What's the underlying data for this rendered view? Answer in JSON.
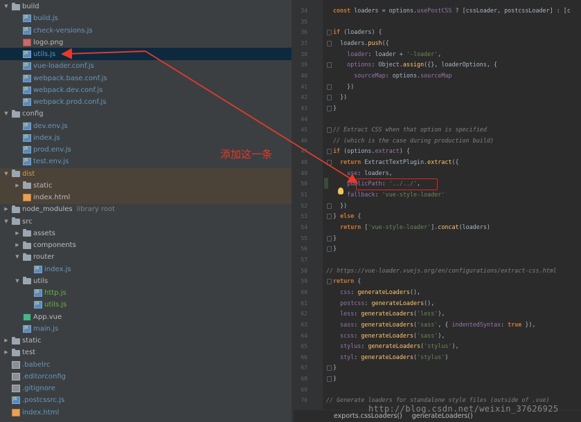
{
  "tree": {
    "rows": [
      {
        "label": "build",
        "kind": "folder",
        "depth": 0,
        "open": true
      },
      {
        "label": "build.js",
        "kind": "js",
        "depth": 1,
        "color": "mod"
      },
      {
        "label": "check-versions.js",
        "kind": "js",
        "depth": 1,
        "color": "mod"
      },
      {
        "label": "logo.png",
        "kind": "png",
        "depth": 1,
        "color": "plain"
      },
      {
        "label": "utils.js",
        "kind": "js",
        "depth": 1,
        "color": "mod",
        "selected": true
      },
      {
        "label": "vue-loader.conf.js",
        "kind": "js",
        "depth": 1,
        "color": "mod"
      },
      {
        "label": "webpack.base.conf.js",
        "kind": "js",
        "depth": 1,
        "color": "mod"
      },
      {
        "label": "webpack.dev.conf.js",
        "kind": "js",
        "depth": 1,
        "color": "mod"
      },
      {
        "label": "webpack.prod.conf.js",
        "kind": "js",
        "depth": 1,
        "color": "mod"
      },
      {
        "label": "config",
        "kind": "folder",
        "depth": 0,
        "open": true
      },
      {
        "label": "dev.env.js",
        "kind": "js",
        "depth": 1,
        "color": "mod"
      },
      {
        "label": "index.js",
        "kind": "js",
        "depth": 1,
        "color": "mod"
      },
      {
        "label": "prod.env.js",
        "kind": "js",
        "depth": 1,
        "color": "mod"
      },
      {
        "label": "test.env.js",
        "kind": "js",
        "depth": 1,
        "color": "mod"
      },
      {
        "label": "dist",
        "kind": "folder",
        "depth": 0,
        "open": true,
        "color": "unt"
      },
      {
        "label": "static",
        "kind": "folder",
        "depth": 1,
        "open": false
      },
      {
        "label": "index.html",
        "kind": "html",
        "depth": 1,
        "color": "plain"
      },
      {
        "label": "node_modules",
        "kind": "folder",
        "depth": 0,
        "open": false,
        "extra": "library root"
      },
      {
        "label": "src",
        "kind": "folder",
        "depth": 0,
        "open": true
      },
      {
        "label": "assets",
        "kind": "folder",
        "depth": 1,
        "open": false
      },
      {
        "label": "components",
        "kind": "folder",
        "depth": 1,
        "open": false
      },
      {
        "label": "router",
        "kind": "folder",
        "depth": 1,
        "open": true
      },
      {
        "label": "index.js",
        "kind": "js",
        "depth": 2,
        "color": "mod"
      },
      {
        "label": "utils",
        "kind": "folder",
        "depth": 1,
        "open": true
      },
      {
        "label": "http.js",
        "kind": "js",
        "depth": 2,
        "color": "add"
      },
      {
        "label": "utils.js",
        "kind": "js",
        "depth": 2,
        "color": "add"
      },
      {
        "label": "App.vue",
        "kind": "vue",
        "depth": 1,
        "color": "plain"
      },
      {
        "label": "main.js",
        "kind": "js",
        "depth": 1,
        "color": "mod"
      },
      {
        "label": "static",
        "kind": "folder",
        "depth": 0,
        "open": false
      },
      {
        "label": "test",
        "kind": "folder",
        "depth": 0,
        "open": false
      },
      {
        "label": ".babelrc",
        "kind": "cfg",
        "depth": 0,
        "color": "mod"
      },
      {
        "label": ".editorconfig",
        "kind": "cfg",
        "depth": 0,
        "color": "mod"
      },
      {
        "label": ".gitignore",
        "kind": "cfg",
        "depth": 0,
        "color": "mod"
      },
      {
        "label": ".postcssrc.js",
        "kind": "js",
        "depth": 0,
        "color": "mod"
      },
      {
        "label": "index.html",
        "kind": "html",
        "depth": 0,
        "color": "mod"
      }
    ]
  },
  "annotation": {
    "note": "添加这一条"
  },
  "editor": {
    "lines": [
      {
        "n": "34",
        "fold": false,
        "tokens": [
          [
            "kw",
            "const "
          ],
          [
            "",
            "loaders = options."
          ],
          [
            "pr",
            "usePostCSS"
          ],
          [
            "",
            " ? [cssLoader, postcssLoader] : [c"
          ]
        ]
      },
      {
        "n": "35",
        "fold": false,
        "tokens": []
      },
      {
        "n": "36",
        "fold": true,
        "tokens": [
          [
            "kw",
            "if "
          ],
          [
            "",
            "(loaders) {"
          ]
        ]
      },
      {
        "n": "37",
        "fold": true,
        "tokens": [
          [
            "",
            "  loaders."
          ],
          [
            "fn",
            "push"
          ],
          [
            "",
            "({"
          ]
        ]
      },
      {
        "n": "38",
        "fold": false,
        "tokens": [
          [
            "pr",
            "    loader"
          ],
          [
            "",
            ": loader + "
          ],
          [
            "st",
            "'-loader'"
          ],
          [
            "",
            ","
          ]
        ]
      },
      {
        "n": "39",
        "fold": true,
        "tokens": [
          [
            "pr",
            "    options"
          ],
          [
            "",
            ": Object."
          ],
          [
            "fn",
            "assign"
          ],
          [
            "",
            "({}, loaderOptions, {"
          ]
        ]
      },
      {
        "n": "40",
        "fold": false,
        "tokens": [
          [
            "pr",
            "      sourceMap"
          ],
          [
            "",
            ": options."
          ],
          [
            "pr",
            "sourceMap"
          ]
        ]
      },
      {
        "n": "41",
        "fold": true,
        "tokens": [
          [
            "",
            "    })"
          ]
        ]
      },
      {
        "n": "42",
        "fold": true,
        "tokens": [
          [
            "",
            "  })"
          ]
        ]
      },
      {
        "n": "43",
        "fold": true,
        "tokens": [
          [
            "",
            "}"
          ]
        ]
      },
      {
        "n": "44",
        "fold": false,
        "tokens": []
      },
      {
        "n": "45",
        "fold": true,
        "tokens": [
          [
            "cm",
            "// Extract CSS when that option is specified"
          ]
        ]
      },
      {
        "n": "46",
        "fold": false,
        "tokens": [
          [
            "cm",
            "// (which is the case during production build)"
          ]
        ]
      },
      {
        "n": "47",
        "fold": true,
        "tokens": [
          [
            "kw",
            "if "
          ],
          [
            "",
            "(options."
          ],
          [
            "pr",
            "extract"
          ],
          [
            "",
            ") {"
          ]
        ]
      },
      {
        "n": "48",
        "fold": true,
        "tokens": [
          [
            "kw",
            "  return "
          ],
          [
            "",
            "ExtractTextPlugin."
          ],
          [
            "fn",
            "extract"
          ],
          [
            "",
            "({"
          ]
        ]
      },
      {
        "n": "49",
        "fold": false,
        "tokens": [
          [
            "pr",
            "    use"
          ],
          [
            "",
            ": loaders,"
          ]
        ]
      },
      {
        "n": "50",
        "fold": false,
        "tokens": [
          [
            "pr",
            "    publicPath"
          ],
          [
            "",
            ": "
          ],
          [
            "st",
            "'../../'"
          ],
          [
            "",
            ","
          ]
        ]
      },
      {
        "n": "51",
        "fold": false,
        "tokens": [
          [
            "pr",
            "    fallback"
          ],
          [
            "",
            ": "
          ],
          [
            "st",
            "'vue-style-loader'"
          ]
        ]
      },
      {
        "n": "52",
        "fold": true,
        "tokens": [
          [
            "",
            "  })"
          ]
        ]
      },
      {
        "n": "53",
        "fold": true,
        "tokens": [
          [
            "",
            "} "
          ],
          [
            "kw",
            "else "
          ],
          [
            "",
            "{"
          ]
        ]
      },
      {
        "n": "54",
        "fold": false,
        "tokens": [
          [
            "kw",
            "  return "
          ],
          [
            "",
            "["
          ],
          [
            "st",
            "'vue-style-loader'"
          ],
          [
            "",
            "]."
          ],
          [
            "fn",
            "concat"
          ],
          [
            "",
            "(loaders)"
          ]
        ]
      },
      {
        "n": "55",
        "fold": true,
        "tokens": [
          [
            "",
            "}"
          ]
        ]
      },
      {
        "n": "56",
        "fold": true,
        "tokens": [
          [
            "",
            "}"
          ]
        ]
      },
      {
        "n": "57",
        "fold": false,
        "tokens": []
      },
      {
        "n": "58",
        "fold": false,
        "tokens": [
          [
            "cm",
            "// https://vue-loader.vuejs.org/en/configurations/extract-css.html"
          ]
        ]
      },
      {
        "n": "59",
        "fold": true,
        "tokens": [
          [
            "kw",
            "return "
          ],
          [
            "",
            "{"
          ]
        ]
      },
      {
        "n": "60",
        "fold": false,
        "tokens": [
          [
            "pr",
            "  css"
          ],
          [
            "",
            ": "
          ],
          [
            "fn",
            "generateLoaders"
          ],
          [
            "",
            "(),"
          ]
        ]
      },
      {
        "n": "61",
        "fold": false,
        "tokens": [
          [
            "pr",
            "  postcss"
          ],
          [
            "",
            ": "
          ],
          [
            "fn",
            "generateLoaders"
          ],
          [
            "",
            "(),"
          ]
        ]
      },
      {
        "n": "62",
        "fold": false,
        "tokens": [
          [
            "pr",
            "  less"
          ],
          [
            "",
            ": "
          ],
          [
            "fn",
            "generateLoaders"
          ],
          [
            "",
            "("
          ],
          [
            "st",
            "'less'"
          ],
          [
            "",
            "),"
          ]
        ]
      },
      {
        "n": "63",
        "fold": false,
        "tokens": [
          [
            "pr",
            "  sass"
          ],
          [
            "",
            ": "
          ],
          [
            "fn",
            "generateLoaders"
          ],
          [
            "",
            "("
          ],
          [
            "st",
            "'sass'"
          ],
          [
            "",
            ", { "
          ],
          [
            "pr",
            "indentedSyntax"
          ],
          [
            "",
            ": "
          ],
          [
            "kw",
            "true "
          ],
          [
            "",
            "}),"
          ]
        ]
      },
      {
        "n": "64",
        "fold": false,
        "tokens": [
          [
            "pr",
            "  scss"
          ],
          [
            "",
            ": "
          ],
          [
            "fn",
            "generateLoaders"
          ],
          [
            "",
            "("
          ],
          [
            "st",
            "'sass'"
          ],
          [
            "",
            "),"
          ]
        ]
      },
      {
        "n": "65",
        "fold": false,
        "tokens": [
          [
            "pr",
            "  stylus"
          ],
          [
            "",
            ": "
          ],
          [
            "fn",
            "generateLoaders"
          ],
          [
            "",
            "("
          ],
          [
            "st",
            "'stylus'"
          ],
          [
            "",
            "),"
          ]
        ]
      },
      {
        "n": "66",
        "fold": false,
        "tokens": [
          [
            "pr",
            "  styl"
          ],
          [
            "",
            ": "
          ],
          [
            "fn",
            "generateLoaders"
          ],
          [
            "",
            "("
          ],
          [
            "st",
            "'stylus'"
          ],
          [
            "",
            ")"
          ]
        ]
      },
      {
        "n": "67",
        "fold": true,
        "tokens": [
          [
            "",
            "}"
          ]
        ]
      },
      {
        "n": "68",
        "fold": true,
        "tokens": [
          [
            "",
            "}"
          ]
        ]
      },
      {
        "n": "69",
        "fold": false,
        "tokens": []
      },
      {
        "n": "70",
        "fold": false,
        "tokens": [
          [
            "cm",
            "// Generate loaders for standalone style files (outside of .vue)"
          ]
        ]
      }
    ]
  },
  "breadcrumb": {
    "items": [
      "exports.cssLoaders()",
      "generateLoaders()"
    ]
  },
  "watermark": "http://blog.csdn.net/weixin_37626925",
  "colors": {
    "annotation": "#e53a2a",
    "keyword": "#cc7832",
    "string": "#6a8759",
    "property": "#9876aa",
    "function": "#ffc66d"
  }
}
